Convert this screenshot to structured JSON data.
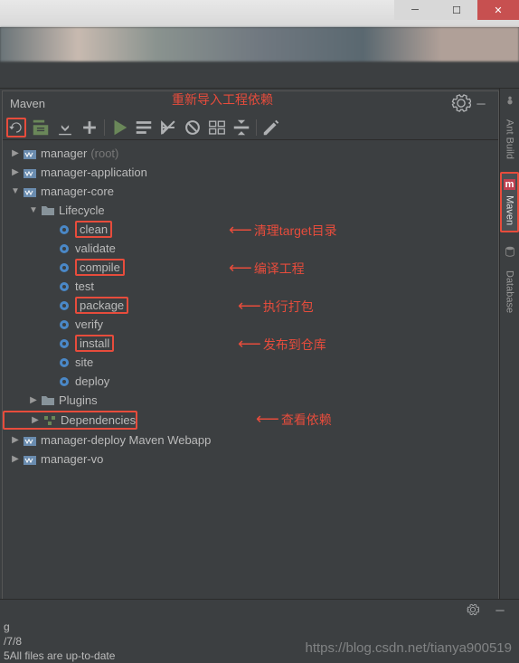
{
  "panel": {
    "title": "Maven"
  },
  "toolbar": {
    "reimport": "Reimport",
    "generate": "Generate Sources",
    "download": "Download Sources",
    "add": "Add Maven Project",
    "run": "Run",
    "execute_goal": "Execute Goal",
    "toggle_offline": "Toggle Offline",
    "skip_tests": "Skip Tests",
    "show_deps": "Show Dependencies",
    "collapse": "Collapse All",
    "settings": "Settings"
  },
  "tree": {
    "root": "manager",
    "root_suffix": "(root)",
    "modules": {
      "app": "manager-application",
      "core": "manager-core",
      "deploy": "manager-deploy Maven Webapp",
      "vo": "manager-vo"
    },
    "lifecycle_label": "Lifecycle",
    "lifecycle": {
      "clean": "clean",
      "validate": "validate",
      "compile": "compile",
      "test": "test",
      "package": "package",
      "verify": "verify",
      "install": "install",
      "site": "site",
      "deploy": "deploy"
    },
    "plugins": "Plugins",
    "dependencies": "Dependencies"
  },
  "annotations": {
    "reimport": "重新导入工程依赖",
    "clean": "清理target目录",
    "compile": "编译工程",
    "package": "执行打包",
    "install": "发布到仓库",
    "deps": "查看依赖"
  },
  "rail": {
    "ant": "Ant Build",
    "maven": "Maven",
    "database": "Database"
  },
  "status": {
    "line1": "g",
    "line2": "/7/8",
    "line3": "5All files are up-to-date"
  },
  "watermark": "https://blog.csdn.net/tianya900519"
}
